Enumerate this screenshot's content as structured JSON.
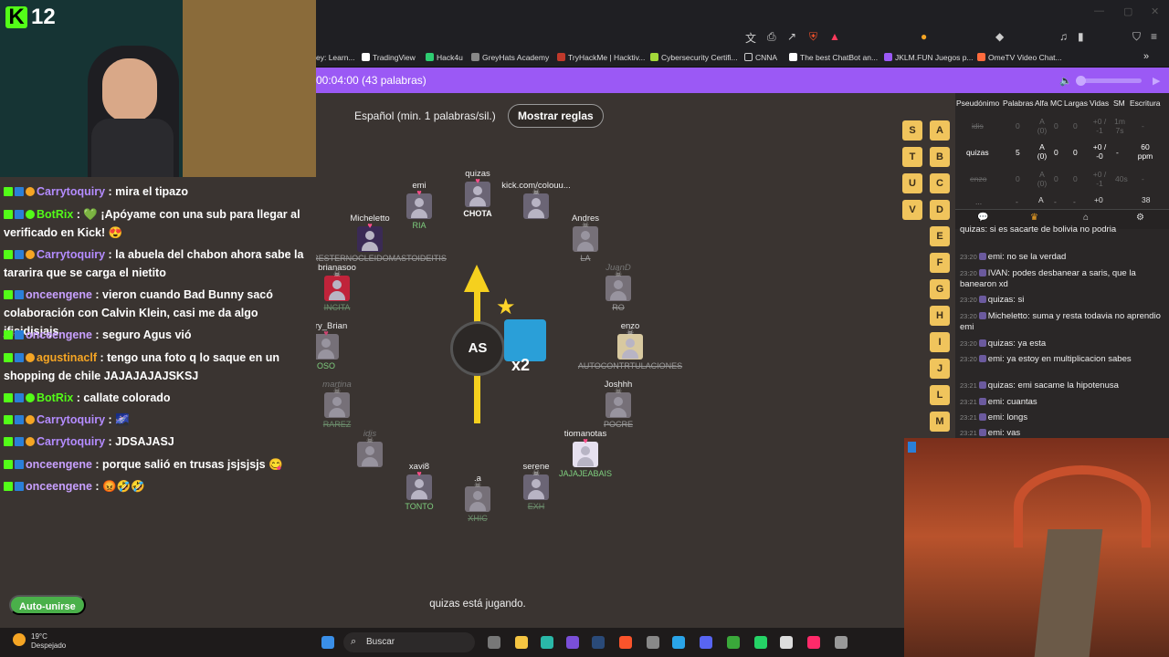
{
  "overlay": {
    "channel_number": "12",
    "kick_letter": "K"
  },
  "browser": {
    "bookmarks": [
      "ey: Learn...",
      "TradingView",
      "Hack4u",
      "GreyHats Academy",
      "TryHackMe | Hacktiv...",
      "Cybersecurity Certifi...",
      "CNNA",
      "The best ChatBot an...",
      "JKLM.FUN Juegos p...",
      "OmeTV Video Chat..."
    ],
    "more_bookmarks": "»"
  },
  "game": {
    "timer": "00:04:00 (43 palabras)",
    "language": "Español (min. 1 palabras/sil.)",
    "rules_button": "Mostrar reglas",
    "syllable": "AS",
    "multiplier": "x2",
    "status": "quizas está jugando.",
    "auto_join": "Auto-unirse",
    "players": [
      {
        "name": "emi",
        "word": "RIA",
        "state": "alive"
      },
      {
        "name": "quizas",
        "word": "CHOTA",
        "state": "current"
      },
      {
        "name": "kick.com/colouu...",
        "word": "",
        "state": "alive"
      },
      {
        "name": "Micheletto",
        "word": "HIPERESTERNOCLEIDOMASTOIDEITIS",
        "state": "alive"
      },
      {
        "name": "Andres",
        "word": "LA",
        "state": "dead"
      },
      {
        "name": "brianasoo",
        "word": "INCITA",
        "state": "dead"
      },
      {
        "name": "JuanD",
        "word": "RO",
        "state": "dead"
      },
      {
        "name": "Zury_Brian",
        "word": "OSO",
        "state": "alive"
      },
      {
        "name": "enzo",
        "word": "AUTOCONTRTULACIONES",
        "state": "dead"
      },
      {
        "name": "martina",
        "word": "RAREZ",
        "state": "dead"
      },
      {
        "name": "Joshhh",
        "word": "POCRE",
        "state": "dead"
      },
      {
        "name": "idis",
        "word": "",
        "state": "dead"
      },
      {
        "name": "tiomanotas",
        "word": "JAJAJEABAIS",
        "state": "alive"
      },
      {
        "name": "xavi8",
        "word": "TONTO",
        "state": "alive"
      },
      {
        "name": ".a",
        "word": "XHIC",
        "state": "dead"
      },
      {
        "name": "serene",
        "word": "EXH",
        "state": "dead"
      }
    ],
    "letters_left": [
      "S",
      "T",
      "U",
      "V"
    ],
    "letters_right": [
      "A",
      "B",
      "C",
      "D",
      "E",
      "F",
      "G",
      "H",
      "I",
      "J",
      "L",
      "M"
    ]
  },
  "scoreboard": {
    "headers": [
      "Pseudónimo",
      "Palabras",
      "Alfa",
      "MC",
      "Largas",
      "Vidas",
      "SM",
      "Escritura"
    ],
    "rows": [
      {
        "name": "idis",
        "palabras": "0",
        "alfa": "A (0)",
        "mc": "0",
        "largas": "0",
        "vidas": "+0 / -1",
        "sm": "1m 7s",
        "escritura": "-"
      },
      {
        "name": "quizas",
        "palabras": "5",
        "alfa": "A (0)",
        "mc": "0",
        "largas": "0",
        "vidas": "+0 / -0",
        "sm": "-",
        "escritura": "60 ppm"
      },
      {
        "name": "enzo",
        "palabras": "0",
        "alfa": "A (0)",
        "mc": "0",
        "largas": "0",
        "vidas": "+0 / -1",
        "sm": "40s",
        "escritura": "-"
      },
      {
        "name": "...",
        "palabras": "-",
        "alfa": "A",
        "mc": "-",
        "largas": "-",
        "vidas": "+0",
        "sm": "",
        "escritura": "38"
      }
    ]
  },
  "side_chat": [
    {
      "time": "",
      "user": "quizas",
      "text": "si es sacarte de bolivia no podria"
    },
    {
      "time": "23:20",
      "user": "emi",
      "text": "no se la verdad"
    },
    {
      "time": "23:20",
      "user": "IVAN",
      "text": "podes desbanear a saris, que la banearon xd"
    },
    {
      "time": "23:20",
      "user": "quizas",
      "text": "si"
    },
    {
      "time": "23:20",
      "user": "Micheletto",
      "text": "suma y resta todavia no aprendio emi"
    },
    {
      "time": "23:20",
      "user": "quizas",
      "text": "ya esta"
    },
    {
      "time": "23:20",
      "user": "emi",
      "text": "ya estoy en multiplicacion sabes"
    },
    {
      "time": "23:21",
      "user": "quizas",
      "text": "emi sacame la hipotenusa"
    },
    {
      "time": "23:21",
      "user": "emi",
      "text": "cuantas"
    },
    {
      "time": "23:21",
      "user": "emi",
      "text": "longs"
    },
    {
      "time": "23:21",
      "user": "emi",
      "text": "vas"
    }
  ],
  "stream_chat": [
    {
      "user": "Carrytoquiry",
      "text": "mira el tipazo",
      "color": "#b48cff"
    },
    {
      "user": "BotRix",
      "text": "💚 ¡Apóyame con una sub para llegar al verificado en Kick! 😍",
      "color": "#53fc18"
    },
    {
      "user": "Carrytoquiry",
      "text": "la abuela del chabon ahora sabe la tararira que se carga el nietito",
      "color": "#b48cff"
    },
    {
      "user": "onceengene",
      "text": "vieron cuando Bad Bunny sacó colaboración con Calvin Klein, casi me da algo jfjsjdjsjajs",
      "color": "#c8a0ff"
    },
    {
      "user": "onceengene",
      "text": "seguro Agus vió",
      "color": "#c8a0ff"
    },
    {
      "user": "agustinaclf",
      "text": "tengo una foto q lo saque en un shopping de chile JAJAJAJAJSKSJ",
      "color": "#f5a524"
    },
    {
      "user": "BotRix",
      "text": "callate colorado",
      "color": "#53fc18"
    },
    {
      "user": "Carrytoquiry",
      "text": "🌌",
      "color": "#b48cff"
    },
    {
      "user": "Carrytoquiry",
      "text": "JDSAJASJ",
      "color": "#b48cff"
    },
    {
      "user": "onceengene",
      "text": "porque salió en trusas jsjsjsjs 😋",
      "color": "#c8a0ff"
    },
    {
      "user": "onceengene",
      "text": "😡🤣🤣",
      "color": "#c8a0ff"
    }
  ],
  "taskbar": {
    "temperature": "19°C",
    "weather": "Despejado",
    "search_placeholder": "Buscar"
  },
  "colors": {
    "accent": "#9b59f5",
    "kick_green": "#53fc18",
    "letter_tile": "#f0c45c",
    "arrow": "#f5d01e"
  }
}
